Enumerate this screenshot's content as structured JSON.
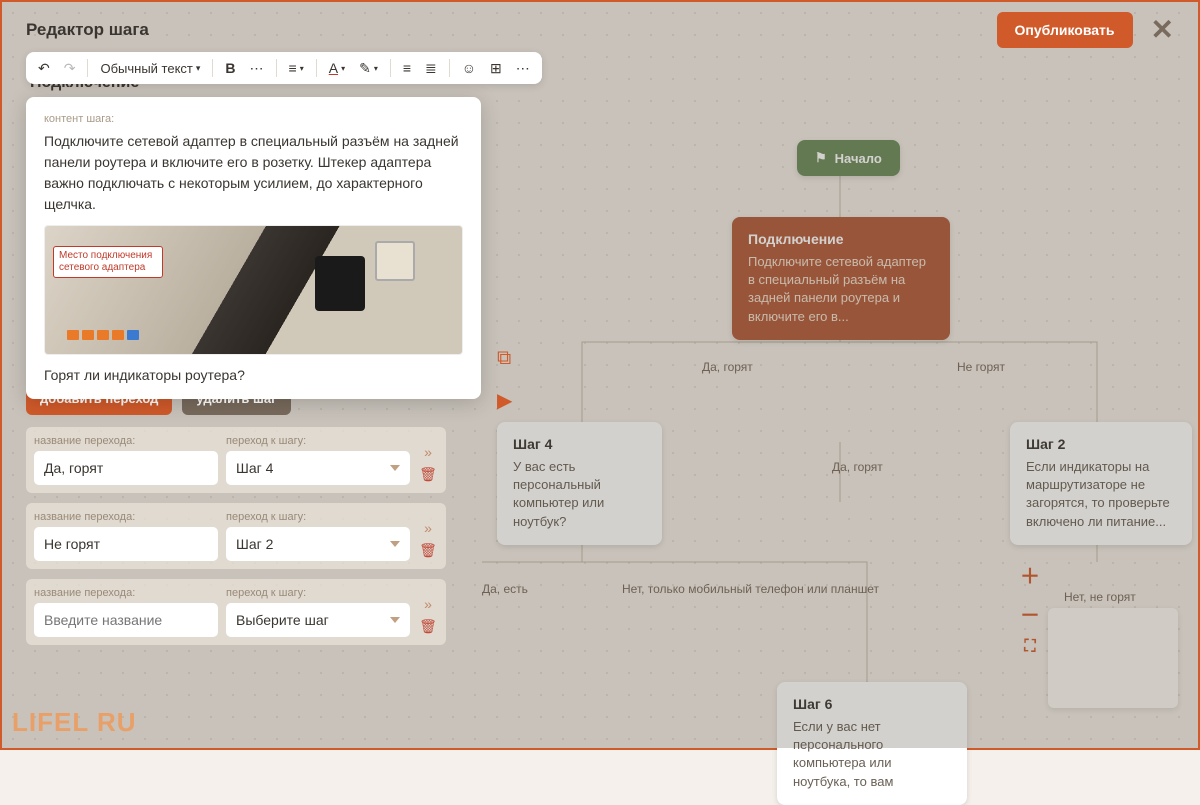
{
  "header": {
    "title": "Редактор шага",
    "publish": "Опубликовать"
  },
  "toolbar": {
    "text_style": "Обычный текст"
  },
  "step": {
    "name": "Подключение",
    "content_label": "контент шага:",
    "content": "Подключите сетевой адаптер в специальный разъём на задней панели роутера и включите его в розетку. Штекер адаптера важно подключать с некоторым усилием, до характерного щелчка.",
    "image_caption": "Место подключения сетевого адаптера",
    "question": "Горят ли индикаторы роутера?"
  },
  "transitions": {
    "add_btn": "добавить переход",
    "del_btn": "удалить шаг",
    "name_label": "название перехода:",
    "target_label": "переход к шагу:",
    "name_placeholder": "Введите название",
    "target_placeholder": "Выберите шаг",
    "rows": [
      {
        "name": "Да, горят",
        "target": "Шаг 4"
      },
      {
        "name": "Не горят",
        "target": "Шаг 2"
      },
      {
        "name": "",
        "target": ""
      }
    ]
  },
  "canvas": {
    "start": "Начало",
    "active": {
      "title": "Подключение",
      "text": "Подключите сетевой адаптер в специальный разъём на задней панели роутера и включите его в..."
    },
    "node4": {
      "title": "Шаг 4",
      "text": "У вас есть персональный компьютер или ноутбук?"
    },
    "node2": {
      "title": "Шаг 2",
      "text": "Если индикаторы на маршрутизаторе не загорятся, то проверьте включено ли питание..."
    },
    "node6": {
      "title": "Шаг 6",
      "text": "Если у вас нет персонального компьютера или ноутбука, то вам"
    },
    "edge_yes": "Да, горят",
    "edge_no": "Не горят",
    "edge_yes2": "Да, горят",
    "edge_haspc": "Да, есть",
    "edge_nopc": "Нет, только мобильный телефон или планшет",
    "edge_nolights": "Нет, не горят"
  },
  "logo": "LIFEL   RU"
}
